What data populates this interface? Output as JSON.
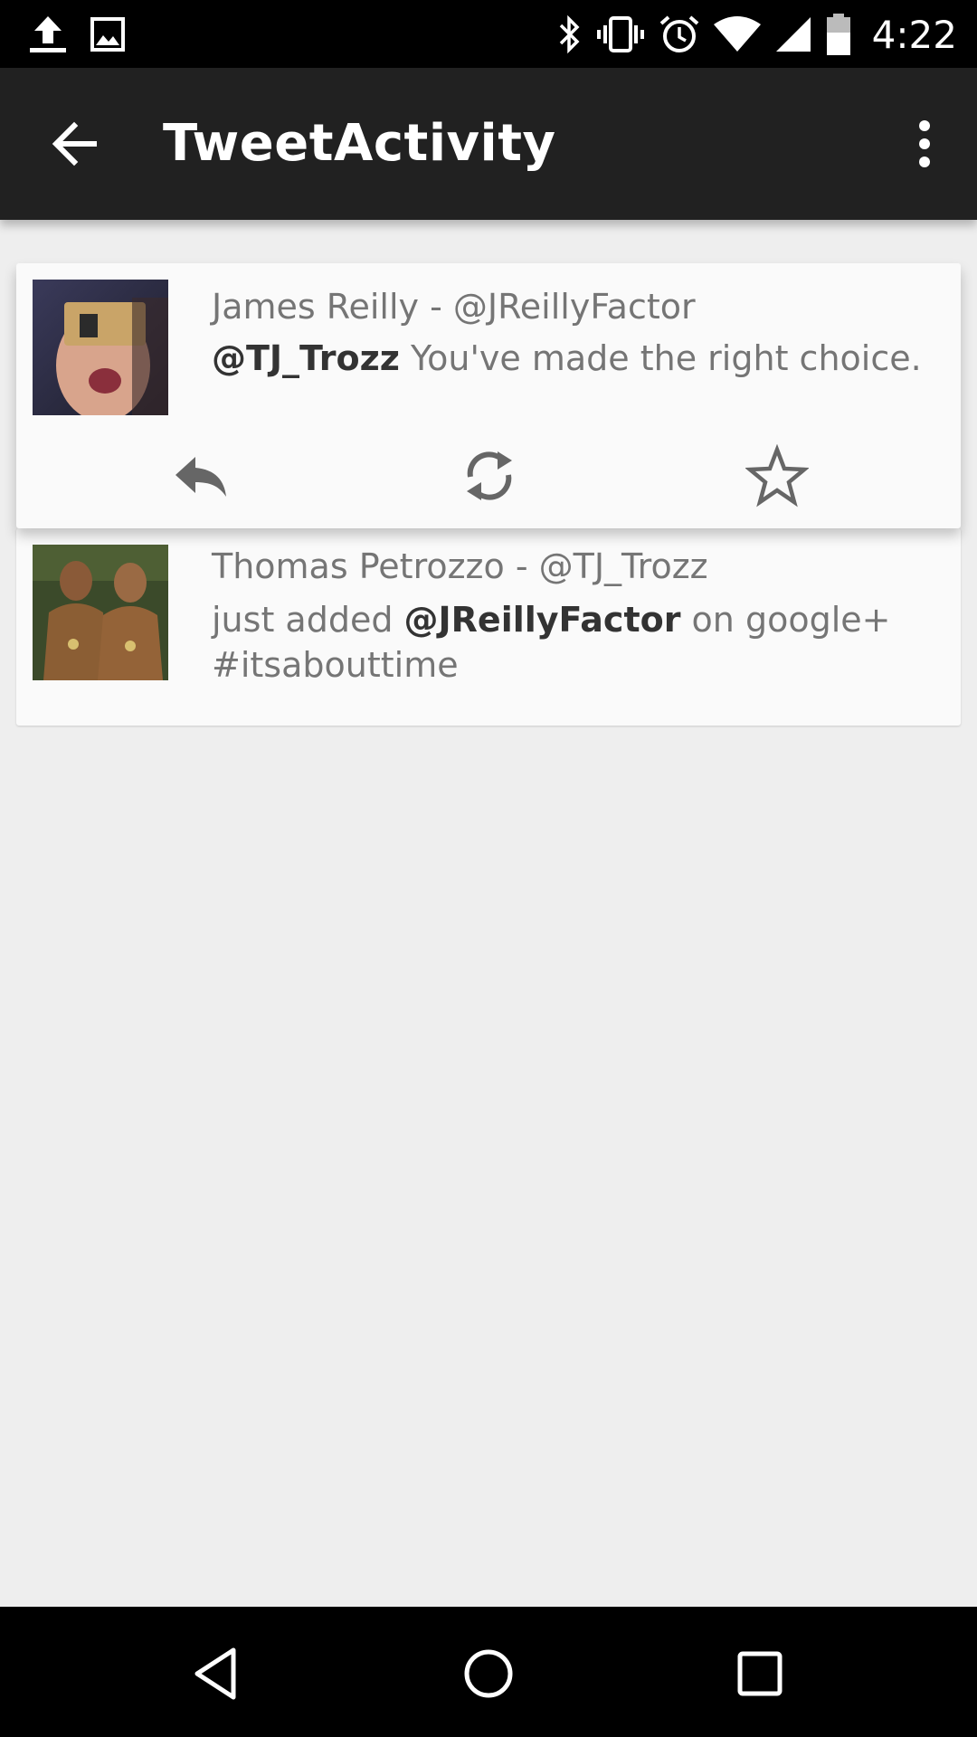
{
  "status_bar": {
    "time": "4:22",
    "left_icons": [
      "upload-icon",
      "image-icon"
    ],
    "right_icons": [
      "bluetooth-icon",
      "vibrate-icon",
      "alarm-icon",
      "wifi-icon",
      "signal-icon",
      "battery-icon"
    ]
  },
  "app_bar": {
    "title": "TweetActivity",
    "back_icon": "arrow-back-icon",
    "menu_icon": "more-vert-icon"
  },
  "tweets": [
    {
      "author": "James Reilly - @JReillyFactor",
      "mention": "@TJ_Trozz",
      "text": " You've made the right choice.",
      "actions": [
        "reply-icon",
        "retweet-icon",
        "star-icon"
      ]
    },
    {
      "author": "Thomas Petrozzo - @TJ_Trozz",
      "text_before": "just added ",
      "mention": "@JReillyFactor",
      "text_after": " on google+ #itsabouttime"
    }
  ],
  "colors": {
    "status_bar": "#000000",
    "app_bar": "#212121",
    "background": "#eeeeee",
    "card": "#fafafa",
    "secondary_text": "#757575"
  }
}
